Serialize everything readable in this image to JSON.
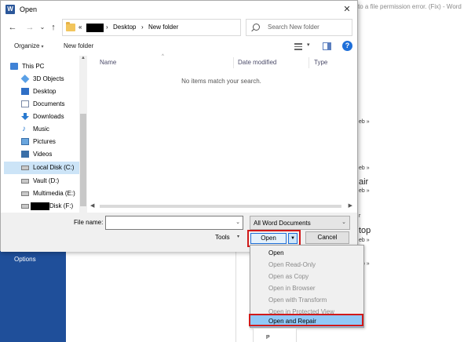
{
  "background": {
    "window_title": "to a file permission error. (Fix) - Word",
    "sidebar_options": "Options",
    "fragments": [
      "eb »",
      "eb »",
      "air",
      "eb »",
      "r",
      "top",
      "eb »",
      "eb »"
    ],
    "partial_text": "P"
  },
  "dialog": {
    "title": "Open",
    "close_glyph": "✕",
    "nav": {
      "back": "←",
      "forward": "→",
      "recent": "⌄",
      "up": "↑"
    },
    "address": {
      "prefix": "«",
      "sep1": "›",
      "crumb1": "Desktop",
      "sep2": "›",
      "crumb2": "New folder",
      "dropdown": "⌄",
      "refresh": "↻"
    },
    "search": {
      "placeholder": "Search New folder"
    },
    "toolbar": {
      "organize": "Organize",
      "organize_caret": "▾",
      "new_folder": "New folder",
      "view_caret": "▾",
      "help": "?"
    },
    "nav_pane": {
      "items": [
        {
          "label": "This PC",
          "icon": "computer-icon"
        },
        {
          "label": "3D Objects",
          "icon": "cube-icon"
        },
        {
          "label": "Desktop",
          "icon": "desktop-icon"
        },
        {
          "label": "Documents",
          "icon": "documents-icon"
        },
        {
          "label": "Downloads",
          "icon": "download-icon"
        },
        {
          "label": "Music",
          "icon": "music-icon"
        },
        {
          "label": "Pictures",
          "icon": "pictures-icon"
        },
        {
          "label": "Videos",
          "icon": "videos-icon"
        },
        {
          "label": "Local Disk (C:)",
          "icon": "disk-icon",
          "selected": true
        },
        {
          "label": "Vault (D:)",
          "icon": "disk-icon"
        },
        {
          "label": "Multimedia (E:)",
          "icon": "disk-icon"
        },
        {
          "label": "Disk (F:)",
          "icon": "disk-icon"
        }
      ],
      "music_glyph": "♪",
      "scroll_up": "▲"
    },
    "file_list": {
      "columns": [
        "Name",
        "Date modified",
        "Type"
      ],
      "sort_caret": "^",
      "empty_message": "No items match your search.",
      "scroll_left": "◀",
      "scroll_right": "▶"
    },
    "bottom": {
      "file_name_label": "File name:",
      "file_name_value": "",
      "file_name_caret": "⌄",
      "file_type": "All Word Documents",
      "file_type_caret": "⌄",
      "tools": "Tools",
      "tools_caret": "▾",
      "open": "Open",
      "open_split": "▼",
      "cancel": "Cancel"
    }
  },
  "open_menu": {
    "items": [
      {
        "label": "Open",
        "state": "enabled"
      },
      {
        "label": "Open Read-Only",
        "state": "disabled"
      },
      {
        "label": "Open as Copy",
        "state": "disabled"
      },
      {
        "label": "Open in Browser",
        "state": "disabled"
      },
      {
        "label": "Open with Transform",
        "state": "disabled"
      },
      {
        "label": "Open in Protected View",
        "state": "disabled"
      },
      {
        "label": "Open and Repair",
        "state": "highlighted"
      }
    ]
  },
  "colors": {
    "annotation_red": "#d11a1a",
    "word_blue": "#1f4f9a",
    "selection": "#cce4f7",
    "menu_highlight": "#91c9f7"
  }
}
